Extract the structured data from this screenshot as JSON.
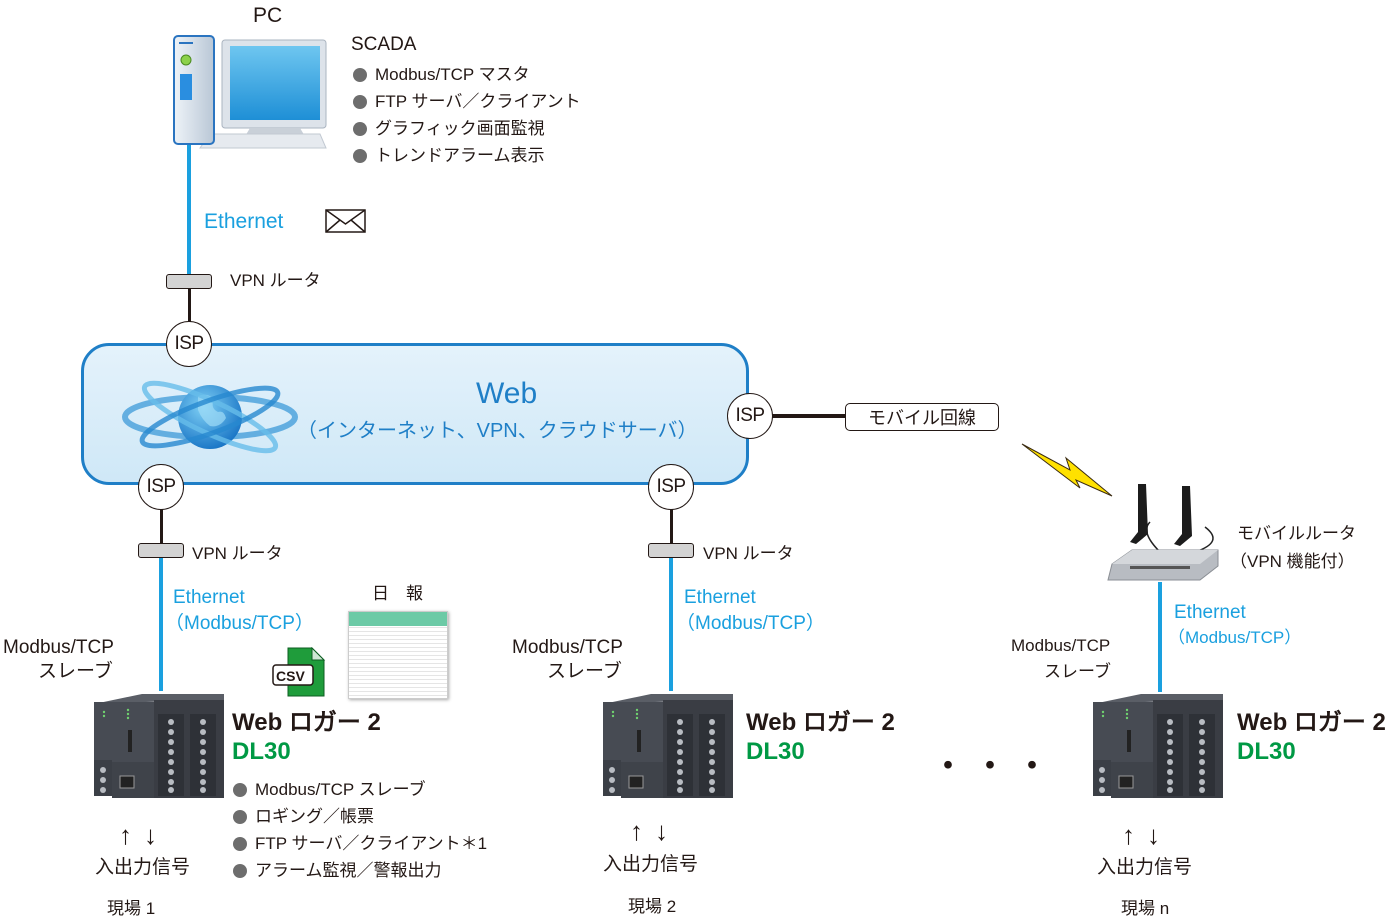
{
  "pc": {
    "label": "PC",
    "software": "SCADA",
    "features": [
      "Modbus/TCP マスタ",
      "FTP サーバ／クライアント",
      "グラフィック画面監視",
      "トレンドアラーム表示"
    ],
    "link_label": "Ethernet",
    "link_icon": "mail-envelope-icon"
  },
  "vpn_router_label": "VPN ルータ",
  "isp_label": "ISP",
  "cloud": {
    "title": "Web",
    "subtitle": "（インターネット、VPN、クラウドサーバ）"
  },
  "mobile_line": "モバイル回線",
  "mobile_router": {
    "line1": "モバイルルータ",
    "line2": "（VPN 機能付）"
  },
  "sites": [
    {
      "ethernet": "Ethernet",
      "protocol": "（Modbus/TCP）",
      "role_line1": "Modbus/TCP",
      "role_line2": "スレーブ",
      "product_name": "Web ロガー 2",
      "product_model": "DL30",
      "io_label": "入出力信号",
      "site_label": "現場 1",
      "features": [
        "Modbus/TCP スレーブ",
        "ロギング／帳票",
        "FTP サーバ／クライアント＊1",
        "アラーム監視／警報出力"
      ],
      "report_label": "日　報",
      "csv_label": "CSV"
    },
    {
      "ethernet": "Ethernet",
      "protocol": "（Modbus/TCP）",
      "role_line1": "Modbus/TCP",
      "role_line2": "スレーブ",
      "product_name": "Web ロガー 2",
      "product_model": "DL30",
      "io_label": "入出力信号",
      "site_label": "現場 2"
    },
    {
      "ethernet": "Ethernet",
      "protocol": "（Modbus/TCP）",
      "role_line1": "Modbus/TCP",
      "role_line2": "スレーブ",
      "product_name": "Web ロガー 2",
      "product_model": "DL30",
      "io_label": "入出力信号",
      "site_label": "現場 n"
    }
  ],
  "ellipsis": "・・・",
  "colors": {
    "ethernet_blue": "#1aa0df",
    "model_green": "#009944",
    "cloud_border": "#1f7fc7",
    "cloud_fill": "#d8edf8",
    "lightning": "#ffe100"
  }
}
